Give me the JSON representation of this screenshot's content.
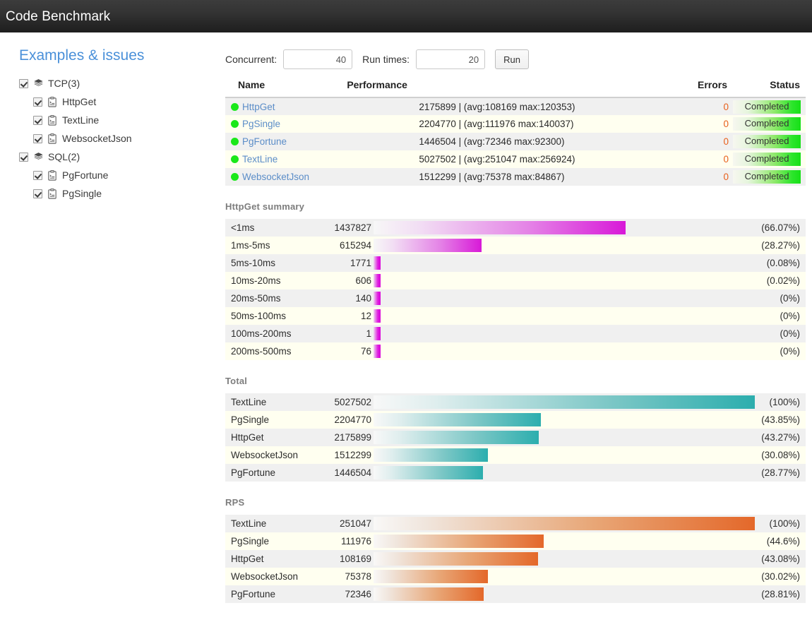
{
  "app": {
    "title": "Code Benchmark"
  },
  "sidebar": {
    "title": "Examples & issues",
    "items": [
      {
        "label": "TCP(3)",
        "level": 0,
        "icon": "stack-icon",
        "checked": true
      },
      {
        "label": "HttpGet",
        "level": 1,
        "icon": "script-icon",
        "checked": true
      },
      {
        "label": "TextLine",
        "level": 1,
        "icon": "script-icon",
        "checked": true
      },
      {
        "label": "WebsocketJson",
        "level": 1,
        "icon": "script-icon",
        "checked": true
      },
      {
        "label": "SQL(2)",
        "level": 0,
        "icon": "stack-icon",
        "checked": true
      },
      {
        "label": "PgFortune",
        "level": 1,
        "icon": "script-icon",
        "checked": true
      },
      {
        "label": "PgSingle",
        "level": 1,
        "icon": "script-icon",
        "checked": true
      }
    ]
  },
  "toolbar": {
    "concurrent_label": "Concurrent:",
    "concurrent_value": "40",
    "concurrent_placeholder": "",
    "runtimes_label": "Run times:",
    "runtimes_value": "20",
    "runtimes_placeholder": "",
    "run_button": "Run"
  },
  "results": {
    "columns": {
      "name": "Name",
      "performance": "Performance",
      "errors": "Errors",
      "status": "Status"
    },
    "rows": [
      {
        "name": "HttpGet",
        "total": "2175899",
        "detail": "| (avg:108169 max:120353)",
        "errors": "0",
        "status": "Completed",
        "dot": "#1ae81a"
      },
      {
        "name": "PgSingle",
        "total": "2204770",
        "detail": "| (avg:111976 max:140037)",
        "errors": "0",
        "status": "Completed",
        "dot": "#1ae81a"
      },
      {
        "name": "PgFortune",
        "total": "1446504",
        "detail": "| (avg:72346 max:92300)",
        "errors": "0",
        "status": "Completed",
        "dot": "#1ae81a"
      },
      {
        "name": "TextLine",
        "total": "5027502",
        "detail": "| (avg:251047 max:256924)",
        "errors": "0",
        "status": "Completed",
        "dot": "#1ae81a"
      },
      {
        "name": "WebsocketJson",
        "total": "1512299",
        "detail": "| (avg:75378 max:84867)",
        "errors": "0",
        "status": "Completed",
        "dot": "#1ae81a"
      }
    ]
  },
  "chart_data": [
    {
      "type": "bar",
      "title": "HttpGet summary",
      "color": "#d819d8",
      "xlabel": "",
      "ylabel": "",
      "orientation": "horizontal",
      "categories": [
        "<1ms",
        "1ms-5ms",
        "5ms-10ms",
        "10ms-20ms",
        "20ms-50ms",
        "50ms-100ms",
        "100ms-200ms",
        "200ms-500ms"
      ],
      "values": [
        1437827,
        615294,
        1771,
        606,
        140,
        12,
        1,
        76
      ],
      "value_labels": [
        "1437827",
        "615294",
        "1771",
        "606",
        "140",
        "12",
        "1",
        "76"
      ],
      "percents": [
        66.07,
        28.27,
        0.08,
        0.02,
        0,
        0,
        0,
        0
      ],
      "percent_labels": [
        "(66.07%)",
        "(28.27%)",
        "(0.08%)",
        "(0.02%)",
        "(0%)",
        "(0%)",
        "(0%)",
        "(0%)"
      ],
      "bar_widths_pct": [
        66.07,
        28.27,
        1.2,
        1.2,
        1.2,
        1.2,
        1.2,
        1.2
      ]
    },
    {
      "type": "bar",
      "title": "Total",
      "color": "#2caeae",
      "xlabel": "",
      "ylabel": "",
      "orientation": "horizontal",
      "categories": [
        "TextLine",
        "PgSingle",
        "HttpGet",
        "WebsocketJson",
        "PgFortune"
      ],
      "values": [
        5027502,
        2204770,
        2175899,
        1512299,
        1446504
      ],
      "value_labels": [
        "5027502",
        "2204770",
        "2175899",
        "1512299",
        "1446504"
      ],
      "percents": [
        100,
        43.85,
        43.27,
        30.08,
        28.77
      ],
      "percent_labels": [
        "(100%)",
        "(43.85%)",
        "(43.27%)",
        "(30.08%)",
        "(28.77%)"
      ],
      "bar_widths_pct": [
        100,
        43.85,
        43.27,
        30.08,
        28.77
      ]
    },
    {
      "type": "bar",
      "title": "RPS",
      "color": "#e4682a",
      "xlabel": "",
      "ylabel": "",
      "orientation": "horizontal",
      "categories": [
        "TextLine",
        "PgSingle",
        "HttpGet",
        "WebsocketJson",
        "PgFortune"
      ],
      "values": [
        251047,
        111976,
        108169,
        75378,
        72346
      ],
      "value_labels": [
        "251047",
        "111976",
        "108169",
        "75378",
        "72346"
      ],
      "percents": [
        100,
        44.6,
        43.08,
        30.02,
        28.81
      ],
      "percent_labels": [
        "(100%)",
        "(44.6%)",
        "(43.08%)",
        "(30.02%)",
        "(28.81%)"
      ],
      "bar_widths_pct": [
        100,
        44.6,
        43.08,
        30.02,
        28.81
      ]
    }
  ]
}
